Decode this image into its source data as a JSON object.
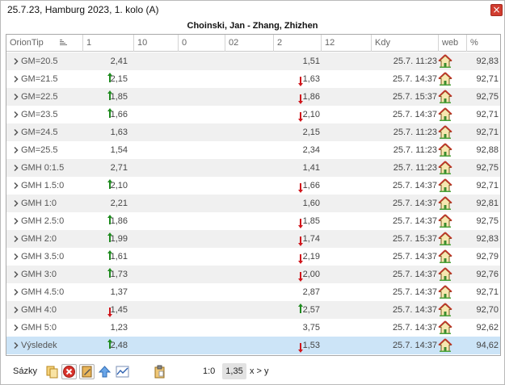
{
  "window": {
    "title": "25.7.23, Hamburg 2023, 1. kolo (A)"
  },
  "match": {
    "title": "Choinski, Jan - Zhang, Zhizhen"
  },
  "columns": [
    "OrionTip",
    "1",
    "10",
    "0",
    "02",
    "2",
    "12",
    "Kdy",
    "web",
    "%"
  ],
  "rows": [
    {
      "tip": "GM=20.5",
      "v1": "2,41",
      "v1_dir": "",
      "v2": "1,51",
      "v2_dir": "",
      "kdy": "25.7. 11:23",
      "pct": "92,83"
    },
    {
      "tip": "GM=21.5",
      "v1": "2,15",
      "v1_dir": "up",
      "v2": "1,63",
      "v2_dir": "down",
      "kdy": "25.7. 14:37",
      "pct": "92,71"
    },
    {
      "tip": "GM=22.5",
      "v1": "1,85",
      "v1_dir": "up",
      "v2": "1,86",
      "v2_dir": "down",
      "kdy": "25.7. 15:37",
      "pct": "92,75"
    },
    {
      "tip": "GM=23.5",
      "v1": "1,66",
      "v1_dir": "up",
      "v2": "2,10",
      "v2_dir": "down",
      "kdy": "25.7. 14:37",
      "pct": "92,71"
    },
    {
      "tip": "GM=24.5",
      "v1": "1,63",
      "v1_dir": "",
      "v2": "2,15",
      "v2_dir": "",
      "kdy": "25.7. 11:23",
      "pct": "92,71"
    },
    {
      "tip": "GM=25.5",
      "v1": "1,54",
      "v1_dir": "",
      "v2": "2,34",
      "v2_dir": "",
      "kdy": "25.7. 11:23",
      "pct": "92,88"
    },
    {
      "tip": "GMH 0:1.5",
      "v1": "2,71",
      "v1_dir": "",
      "v2": "1,41",
      "v2_dir": "",
      "kdy": "25.7. 11:23",
      "pct": "92,75"
    },
    {
      "tip": "GMH 1.5:0",
      "v1": "2,10",
      "v1_dir": "up",
      "v2": "1,66",
      "v2_dir": "down",
      "kdy": "25.7. 14:37",
      "pct": "92,71"
    },
    {
      "tip": "GMH 1:0",
      "v1": "2,21",
      "v1_dir": "",
      "v2": "1,60",
      "v2_dir": "",
      "kdy": "25.7. 14:37",
      "pct": "92,81"
    },
    {
      "tip": "GMH 2.5:0",
      "v1": "1,86",
      "v1_dir": "up",
      "v2": "1,85",
      "v2_dir": "down",
      "kdy": "25.7. 14:37",
      "pct": "92,75"
    },
    {
      "tip": "GMH 2:0",
      "v1": "1,99",
      "v1_dir": "up",
      "v2": "1,74",
      "v2_dir": "down",
      "kdy": "25.7. 15:37",
      "pct": "92,83"
    },
    {
      "tip": "GMH 3.5:0",
      "v1": "1,61",
      "v1_dir": "up",
      "v2": "2,19",
      "v2_dir": "down",
      "kdy": "25.7. 14:37",
      "pct": "92,79"
    },
    {
      "tip": "GMH 3:0",
      "v1": "1,73",
      "v1_dir": "up",
      "v2": "2,00",
      "v2_dir": "down",
      "kdy": "25.7. 14:37",
      "pct": "92,76"
    },
    {
      "tip": "GMH 4.5:0",
      "v1": "1,37",
      "v1_dir": "",
      "v2": "2,87",
      "v2_dir": "",
      "kdy": "25.7. 14:37",
      "pct": "92,71"
    },
    {
      "tip": "GMH 4:0",
      "v1": "1,45",
      "v1_dir": "down",
      "v2": "2,57",
      "v2_dir": "up",
      "kdy": "25.7. 14:37",
      "pct": "92,70"
    },
    {
      "tip": "GMH 5:0",
      "v1": "1,23",
      "v1_dir": "",
      "v2": "3,75",
      "v2_dir": "",
      "kdy": "25.7. 14:37",
      "pct": "92,62"
    },
    {
      "tip": "Výsledek",
      "v1": "2,48",
      "v1_dir": "up",
      "v2": "1,53",
      "v2_dir": "down",
      "kdy": "25.7. 14:37",
      "pct": "94,62",
      "selected": true
    }
  ],
  "footer": {
    "label": "Sázky",
    "tip": "1:0",
    "odds": "1,35",
    "relation": "x > y"
  },
  "icons": {
    "web": "home-icon",
    "up": "arrow-up-icon",
    "down": "arrow-down-icon",
    "expand": "chevron-right-icon"
  },
  "colors": {
    "up_arrow": "#1e8a1e",
    "down_arrow": "#d0161c",
    "selected_row": "#cce4f7",
    "odd_row": "#f0f0f0"
  }
}
